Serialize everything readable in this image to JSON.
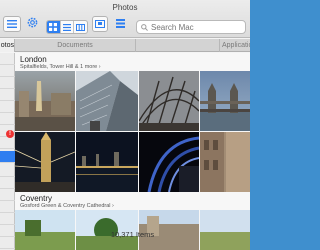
{
  "window": {
    "title": "Photos"
  },
  "toolbar": {
    "search_placeholder": "Search Mac"
  },
  "tabs": [
    {
      "label": "otos"
    },
    {
      "label": "Documents"
    },
    {
      "label": ""
    },
    {
      "label": "Applicatio"
    }
  ],
  "sidebar": {
    "badge": "!"
  },
  "moments": [
    {
      "title": "London",
      "subtitle": "Spitalfields, Tower Hill & 1 more ›"
    },
    {
      "title": "Coventry",
      "subtitle": "Gosford Green & Coventry Cathedral ›"
    }
  ],
  "status": {
    "item_count": "10,371 Items"
  },
  "colors": {
    "accent": "#2e7ff1",
    "desktop": "#3f8fce"
  },
  "icons": [
    "list-icon",
    "settings-gear-icon",
    "grid-view-icon",
    "list-view-icon",
    "column-view-icon",
    "cover-flow-icon",
    "group-menu-icon",
    "search-icon",
    "notification-badge"
  ]
}
